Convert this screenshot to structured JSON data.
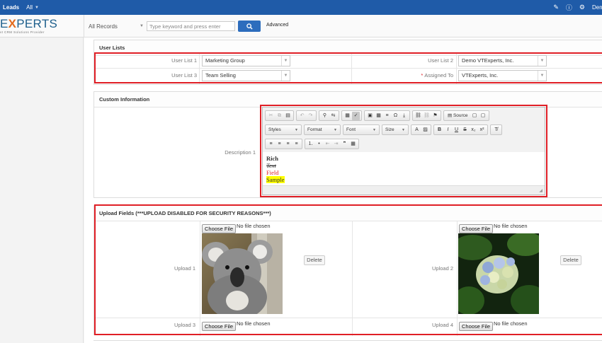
{
  "topbar": {
    "module": "Leads",
    "filter": "All",
    "user": "Demo"
  },
  "search": {
    "record_scope": "All Records",
    "placeholder": "Type keyword and press enter",
    "advanced_label": "Advanced"
  },
  "logo": {
    "word_pre": "E",
    "word_x": "X",
    "word_post": "PERTS",
    "tagline": "vt CRM Solutions Provider"
  },
  "user_lists": {
    "title": "User Lists",
    "fields": [
      {
        "label": "User List 1",
        "value": "Marketing Group"
      },
      {
        "label": "User List 2",
        "value": "Demo VTExperts, Inc."
      },
      {
        "label": "User List 3",
        "value": "Team Selling"
      },
      {
        "label": "Assigned To",
        "value": "VTExperts, Inc.",
        "required": "*"
      }
    ]
  },
  "custom_info": {
    "title": "Custom Information",
    "description_label": "Description 1",
    "toolbar": {
      "source_label": "Source",
      "styles_label": "Styles",
      "format_label": "Format",
      "font_label": "Font",
      "size_label": "Size"
    },
    "content": {
      "line1": "Rich",
      "line2": "Text",
      "line3": "Field",
      "line4": "Sample"
    }
  },
  "uploads": {
    "title": "Upload Fields (***UPLOAD DISABLED FOR SECURITY REASONS***)",
    "choose_label": "Choose File",
    "no_file": "No file chosen",
    "delete_label": "Delete",
    "fields": [
      "Upload 1",
      "Upload 2",
      "Upload 3",
      "Upload 4"
    ]
  },
  "colors": {
    "topbar": "#1f5ba8",
    "highlight": "#e01f26",
    "accent": "#e36b1e"
  }
}
